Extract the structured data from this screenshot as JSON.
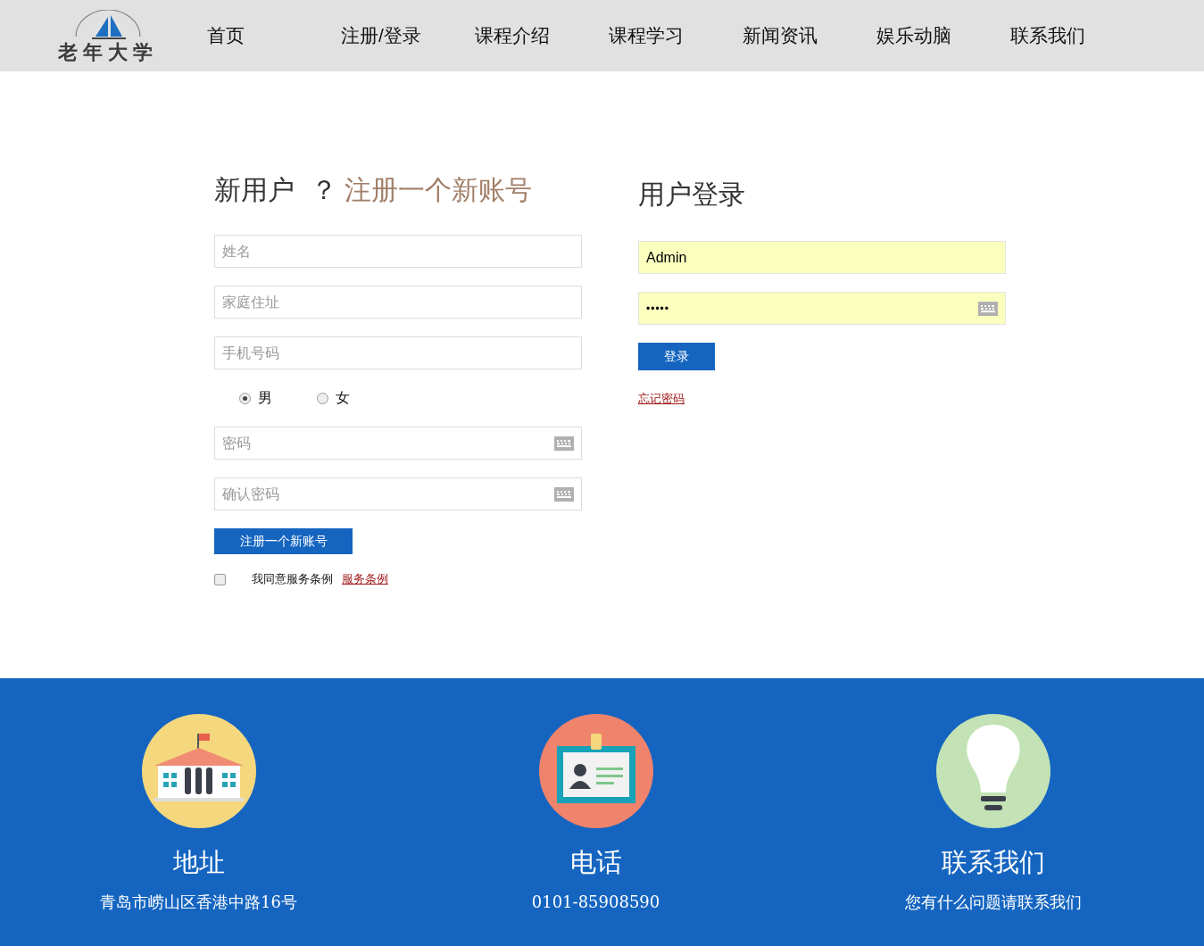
{
  "header": {
    "logo_text": "老年大学",
    "nav": [
      {
        "label": "首页"
      },
      {
        "label": "注册/登录"
      },
      {
        "label": "课程介绍"
      },
      {
        "label": "课程学习"
      },
      {
        "label": "新闻资讯"
      },
      {
        "label": "娱乐动脑"
      },
      {
        "label": "联系我们"
      }
    ]
  },
  "register": {
    "title": "新用户",
    "question": "？",
    "title_link": "注册一个新账号",
    "fields": [
      {
        "kind": "text",
        "placeholder": "姓名"
      },
      {
        "kind": "text",
        "placeholder": "家庭住址"
      },
      {
        "kind": "text",
        "placeholder": "手机号码"
      },
      {
        "kind": "gender",
        "options": [
          {
            "label": "男",
            "selected": true
          },
          {
            "label": "女",
            "selected": false
          }
        ]
      },
      {
        "kind": "password",
        "placeholder": "密码"
      },
      {
        "kind": "password",
        "placeholder": "确认密码"
      }
    ],
    "submit": "注册一个新账号",
    "agree": {
      "checked": false,
      "label": "我同意服务条例",
      "link": "服务条例"
    }
  },
  "login": {
    "title": "用户登录",
    "fields": [
      {
        "kind": "text",
        "value": "Admin",
        "autofilled": true
      },
      {
        "kind": "password",
        "value": "•••••",
        "autofilled": true
      }
    ],
    "submit": "登录",
    "forgot": "忘记密码"
  },
  "footer": [
    {
      "kind": "building",
      "title": "地址",
      "text": "青岛市崂山区香港中路16号"
    },
    {
      "kind": "card",
      "title": "电话",
      "text": "0101-85908590"
    },
    {
      "kind": "bulb",
      "title": "联系我们",
      "text": "您有什么问题请联系我们"
    }
  ]
}
